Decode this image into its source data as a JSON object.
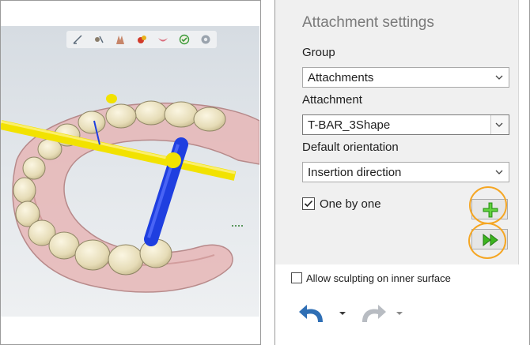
{
  "viewport": {
    "toolbar_icons": [
      "margin-line-icon",
      "crown-tool-icon",
      "tooth-shape-icon",
      "color-tool-icon",
      "gingiva-icon",
      "bite-icon",
      "view-options-icon"
    ]
  },
  "settings": {
    "title": "Attachment settings",
    "group_label": "Group",
    "group_value": "Attachments",
    "attachment_label": "Attachment",
    "attachment_value": "T-BAR_3Shape",
    "orientation_label": "Default orientation",
    "orientation_value": "Insertion direction",
    "one_by_one_label": "One by one",
    "one_by_one_checked": true,
    "add_button_icon": "plus-icon",
    "add_all_button_icon": "fast-forward-icon"
  },
  "options": {
    "sculpt_inner_label": "Allow sculpting on inner surface",
    "sculpt_inner_checked": false
  },
  "history": {
    "undo_icon": "undo-icon",
    "redo_icon": "redo-icon"
  },
  "colors": {
    "accent_green": "#3cb51f",
    "highlight_orange": "#f5a623",
    "undo_blue": "#2f6fb5",
    "attachment_yellow": "#f2e200",
    "insertion_axis_blue": "#1f3fe0"
  }
}
